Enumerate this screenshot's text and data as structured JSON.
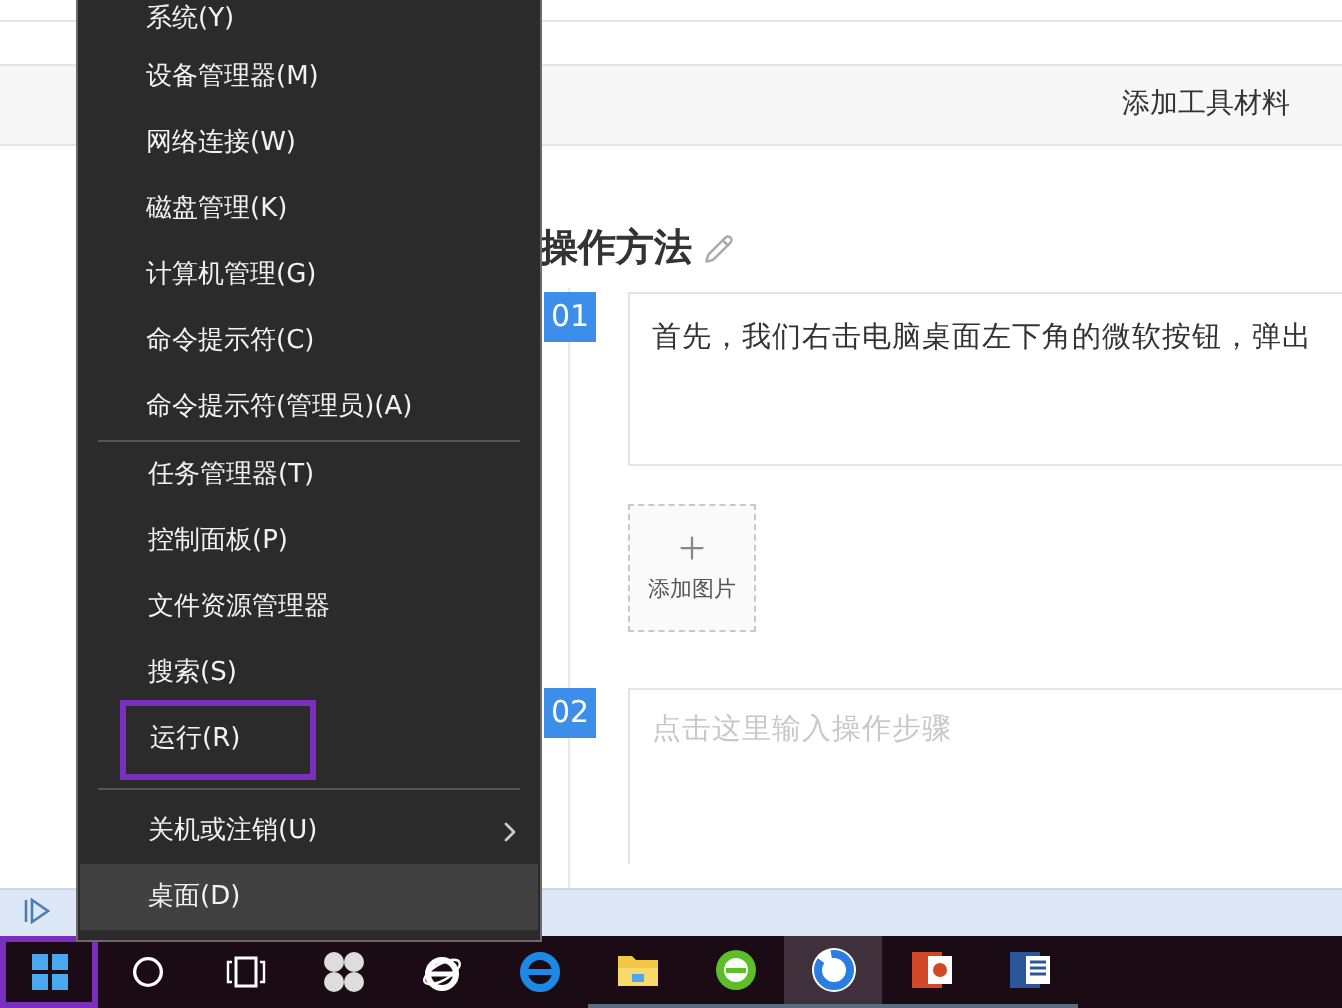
{
  "page": {
    "toolbar": {
      "add_materials": "添加工具材料"
    },
    "section_title": "操作方法",
    "steps": [
      {
        "number": "01",
        "text": "首先，我们右击电脑桌面左下角的微软按钮，弹出",
        "add_image": "添加图片"
      },
      {
        "number": "02",
        "placeholder": "点击这里输入操作步骤"
      }
    ]
  },
  "context_menu": {
    "groups": [
      {
        "items": [
          {
            "label": "系统(Y)",
            "selected": false,
            "highlighted": false,
            "has_submenu": false
          },
          {
            "label": "设备管理器(M)",
            "selected": false,
            "highlighted": false,
            "has_submenu": false
          },
          {
            "label": "网络连接(W)",
            "selected": false,
            "highlighted": false,
            "has_submenu": false
          },
          {
            "label": "磁盘管理(K)",
            "selected": false,
            "highlighted": false,
            "has_submenu": false
          },
          {
            "label": "计算机管理(G)",
            "selected": false,
            "highlighted": false,
            "has_submenu": false
          },
          {
            "label": "命令提示符(C)",
            "selected": false,
            "highlighted": false,
            "has_submenu": false
          },
          {
            "label": "命令提示符(管理员)(A)",
            "selected": false,
            "highlighted": false,
            "has_submenu": false
          }
        ]
      },
      {
        "items": [
          {
            "label": "任务管理器(T)",
            "selected": false,
            "highlighted": false,
            "has_submenu": false
          },
          {
            "label": "控制面板(P)",
            "selected": false,
            "highlighted": false,
            "has_submenu": false
          },
          {
            "label": "文件资源管理器",
            "selected": false,
            "highlighted": false,
            "has_submenu": false
          },
          {
            "label": "搜索(S)",
            "selected": false,
            "highlighted": false,
            "has_submenu": false
          },
          {
            "label": "运行(R)",
            "selected": false,
            "highlighted": true,
            "has_submenu": false
          }
        ]
      },
      {
        "items": [
          {
            "label": "关机或注销(U)",
            "selected": false,
            "highlighted": false,
            "has_submenu": true
          },
          {
            "label": "桌面(D)",
            "selected": true,
            "highlighted": false,
            "has_submenu": false
          }
        ]
      }
    ]
  },
  "taskbar": {
    "buttons": [
      {
        "kind": "start",
        "selected": false,
        "highlighted": true,
        "running": false
      },
      {
        "kind": "cortana",
        "selected": false,
        "highlighted": false,
        "running": false
      },
      {
        "kind": "taskview",
        "selected": false,
        "highlighted": false,
        "running": false
      },
      {
        "kind": "fan",
        "selected": false,
        "highlighted": false,
        "running": false
      },
      {
        "kind": "ie",
        "selected": false,
        "highlighted": false,
        "running": false
      },
      {
        "kind": "edge",
        "selected": false,
        "highlighted": false,
        "running": false
      },
      {
        "kind": "folder",
        "selected": false,
        "highlighted": false,
        "running": true
      },
      {
        "kind": "browser360",
        "selected": false,
        "highlighted": false,
        "running": true
      },
      {
        "kind": "sogou",
        "selected": true,
        "highlighted": false,
        "running": true
      },
      {
        "kind": "powerpoint",
        "selected": false,
        "highlighted": false,
        "running": true
      },
      {
        "kind": "word",
        "selected": false,
        "highlighted": false,
        "running": true
      }
    ]
  }
}
